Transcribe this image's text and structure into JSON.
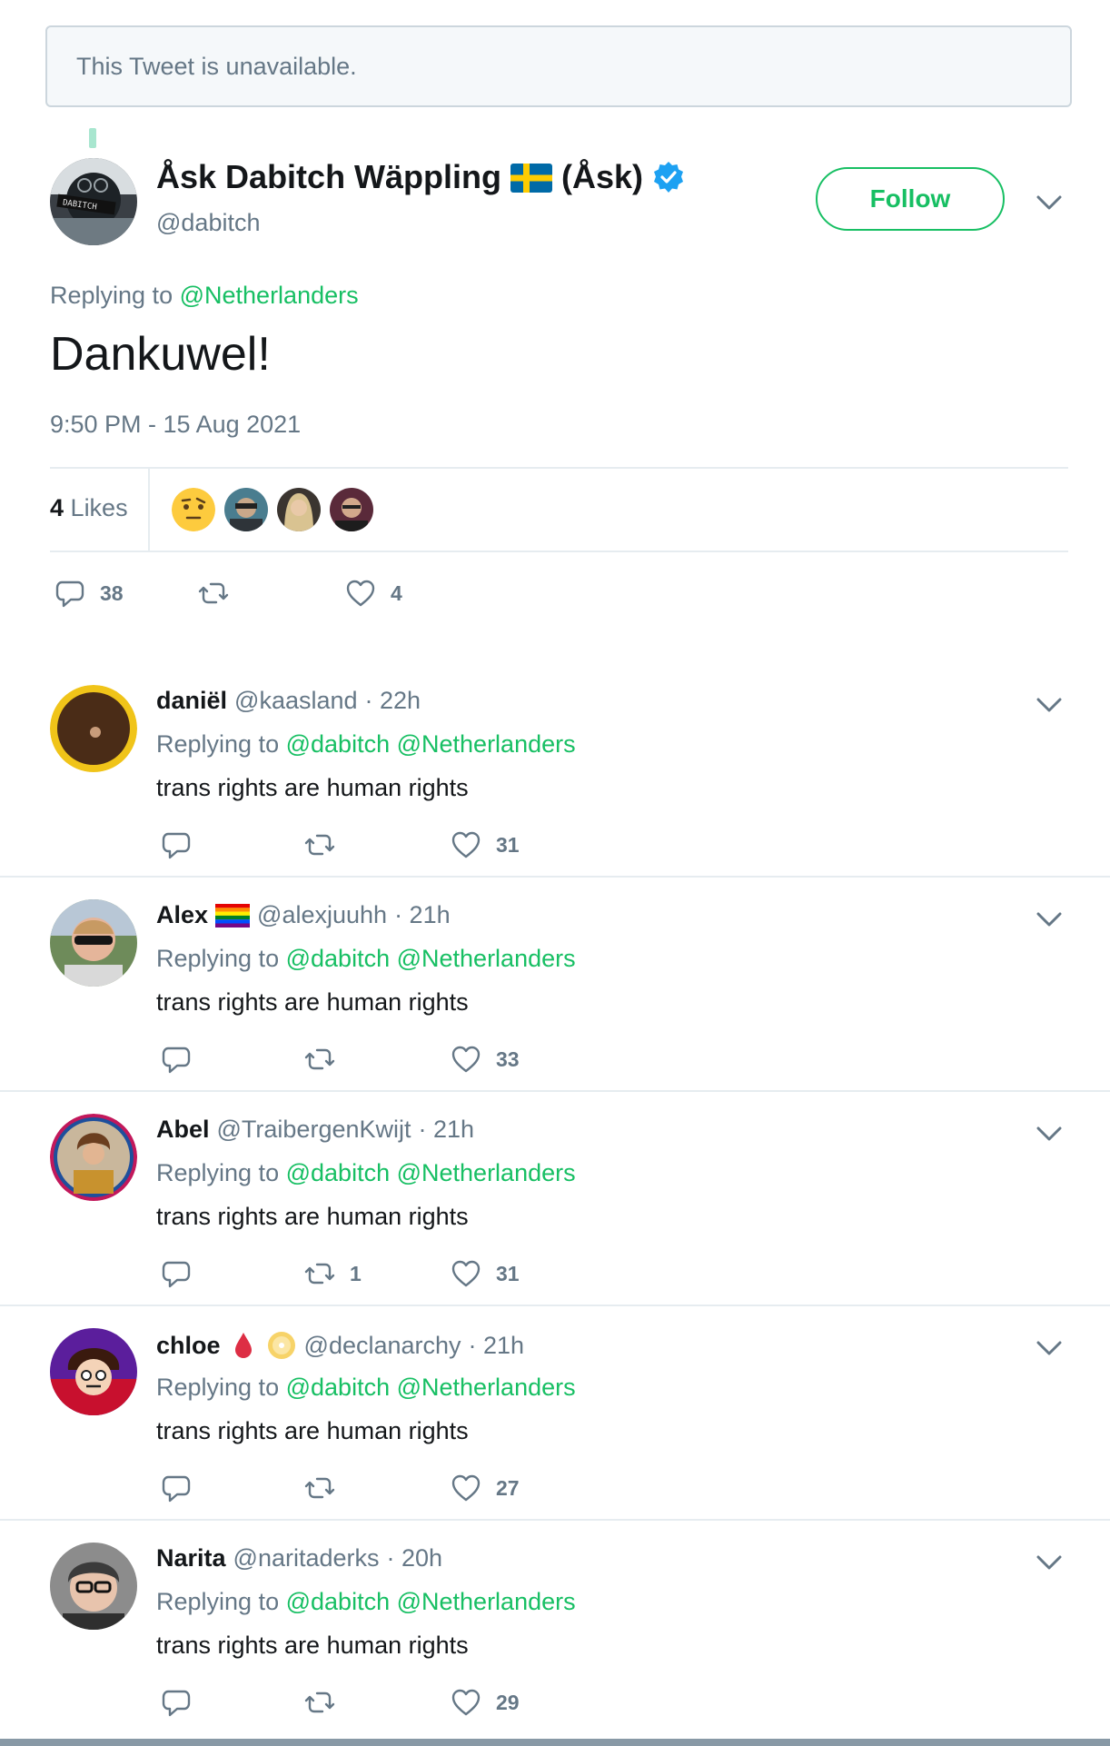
{
  "unavailable_notice": "This Tweet is unavailable.",
  "main_tweet": {
    "display_name": "Åsk Dabitch Wäppling",
    "name_suffix": "(Åsk)",
    "handle": "@dabitch",
    "follow_label": "Follow",
    "replying_label": "Replying to",
    "replying_to": "@Netherlanders",
    "text": "Dankuwel!",
    "timestamp": "9:50 PM - 15 Aug 2021",
    "likes_count": "4",
    "likes_label": "Likes",
    "reply_count": "38",
    "retweet_count": "",
    "like_count": "4"
  },
  "replies": [
    {
      "name": "daniël",
      "handle": "@kaasland",
      "time": "· 22h",
      "replying_label": "Replying to",
      "mention1": "@dabitch",
      "mention2": "@Netherlanders",
      "text": "trans rights are human rights",
      "reply_count": "",
      "retweet_count": "",
      "like_count": "31"
    },
    {
      "name": "Alex",
      "handle": "@alexjuuhh",
      "time": "· 21h",
      "replying_label": "Replying to",
      "mention1": "@dabitch",
      "mention2": "@Netherlanders",
      "text": "trans rights are human rights",
      "reply_count": "",
      "retweet_count": "",
      "like_count": "33"
    },
    {
      "name": "Abel",
      "handle": "@TraibergenKwijt",
      "time": "· 21h",
      "replying_label": "Replying to",
      "mention1": "@dabitch",
      "mention2": "@Netherlanders",
      "text": "trans rights are human rights",
      "reply_count": "",
      "retweet_count": "1",
      "like_count": "31"
    },
    {
      "name": "chloe",
      "handle": "@declanarchy",
      "time": "· 21h",
      "replying_label": "Replying to",
      "mention1": "@dabitch",
      "mention2": "@Netherlanders",
      "text": "trans rights are human rights",
      "reply_count": "",
      "retweet_count": "",
      "like_count": "27"
    },
    {
      "name": "Narita",
      "handle": "@naritaderks",
      "time": "· 20h",
      "replying_label": "Replying to",
      "mention1": "@dabitch",
      "mention2": "@Netherlanders",
      "text": "trans rights are human rights",
      "reply_count": "",
      "retweet_count": "",
      "like_count": "29"
    }
  ],
  "colors": {
    "accent": "#17bf63",
    "muted": "#657786",
    "verified": "#1da1f2",
    "border": "#e6ecf0"
  },
  "icons": [
    "reply-icon",
    "retweet-icon",
    "like-icon",
    "chevron-down-icon",
    "verified-badge-icon",
    "sweden-flag-icon",
    "pride-flag-icon",
    "blood-drop-icon",
    "disc-icon"
  ]
}
